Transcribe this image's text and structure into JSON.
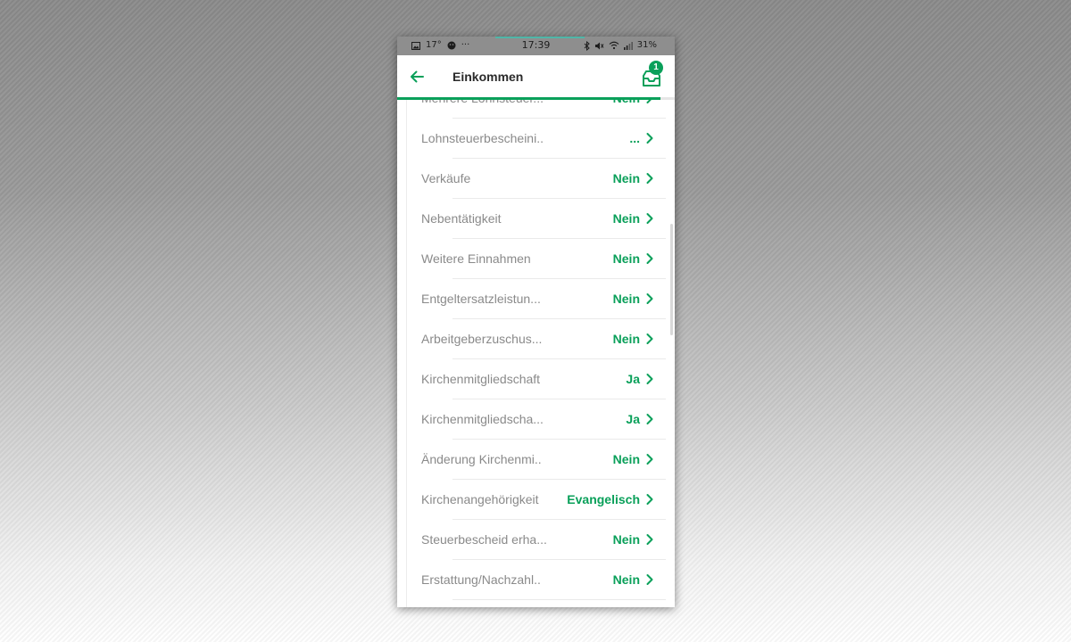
{
  "status_bar": {
    "time": "17:39",
    "temperature": "17°",
    "overflow": "···",
    "battery": "31%",
    "icons_left": [
      "image-icon",
      "face-icon"
    ],
    "icons_right": [
      "bluetooth-icon",
      "mute-icon",
      "wifi-icon",
      "signal-icon"
    ]
  },
  "app_bar": {
    "title": "Einkommen",
    "inbox_badge": "1"
  },
  "progress": {
    "fraction": 0.95,
    "color": "#0aa05a"
  },
  "list": {
    "items": [
      {
        "label": "Mehrere Lohnsteuer...",
        "value": "Nein"
      },
      {
        "label": "Lohnsteuerbescheini..",
        "value": "..."
      },
      {
        "label": "Verkäufe",
        "value": "Nein"
      },
      {
        "label": "Nebentätigkeit",
        "value": "Nein"
      },
      {
        "label": "Weitere Einnahmen",
        "value": "Nein"
      },
      {
        "label": "Entgeltersatzleistun...",
        "value": "Nein"
      },
      {
        "label": "Arbeitgeberzuschus...",
        "value": "Nein"
      },
      {
        "label": "Kirchenmitgliedschaft",
        "value": "Ja"
      },
      {
        "label": "Kirchenmitgliedscha...",
        "value": "Ja"
      },
      {
        "label": "Änderung Kirchenmi..",
        "value": "Nein"
      },
      {
        "label": "Kirchenangehörigkeit",
        "value": "Evangelisch"
      },
      {
        "label": "Steuerbescheid erha...",
        "value": "Nein"
      },
      {
        "label": "Erstattung/Nachzahl..",
        "value": "Nein"
      }
    ]
  },
  "colors": {
    "accent": "#0aa05a",
    "label_gray": "#8a8a8a",
    "status_bar": "#8e8e8e"
  }
}
